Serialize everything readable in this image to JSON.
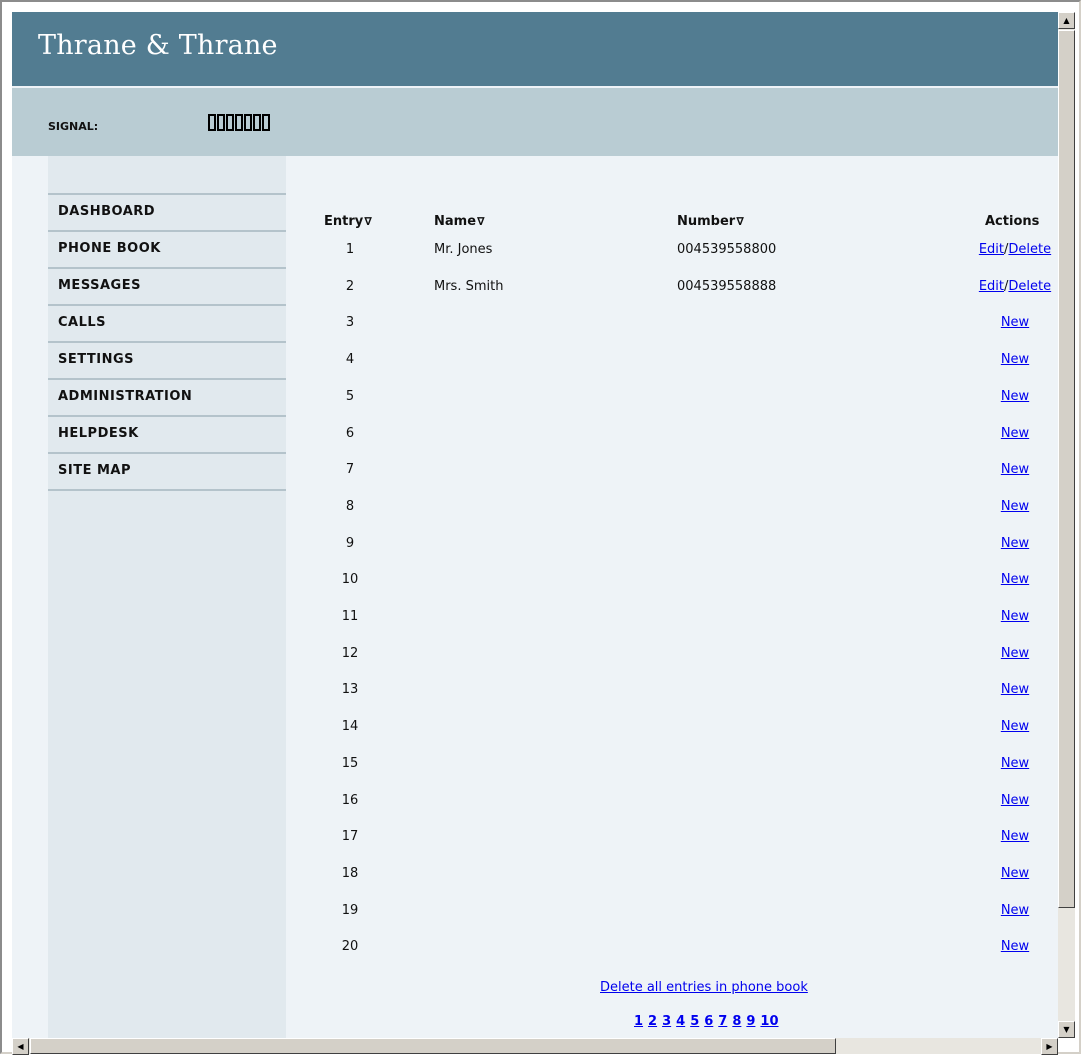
{
  "header": {
    "brand": "Thrane & Thrane"
  },
  "signal": {
    "label": "SIGNAL:",
    "bars": 7
  },
  "sidebar": {
    "items": [
      {
        "label": "DASHBOARD"
      },
      {
        "label": "PHONE BOOK"
      },
      {
        "label": "MESSAGES"
      },
      {
        "label": "CALLS"
      },
      {
        "label": "SETTINGS"
      },
      {
        "label": "ADMINISTRATION"
      },
      {
        "label": "HELPDESK"
      },
      {
        "label": "SITE MAP"
      }
    ]
  },
  "table": {
    "headers": {
      "entry": "Entry",
      "name": "Name",
      "number": "Number",
      "actions": "Actions",
      "sort_glyph": "∇"
    },
    "edit_label": "Edit",
    "separator": "/",
    "delete_label": "Delete",
    "new_label": "New",
    "rows": [
      {
        "entry": "1",
        "name": "Mr. Jones",
        "number": "004539558800"
      },
      {
        "entry": "2",
        "name": "Mrs. Smith",
        "number": "004539558888"
      },
      {
        "entry": "3",
        "name": "",
        "number": ""
      },
      {
        "entry": "4",
        "name": "",
        "number": ""
      },
      {
        "entry": "5",
        "name": "",
        "number": ""
      },
      {
        "entry": "6",
        "name": "",
        "number": ""
      },
      {
        "entry": "7",
        "name": "",
        "number": ""
      },
      {
        "entry": "8",
        "name": "",
        "number": ""
      },
      {
        "entry": "9",
        "name": "",
        "number": ""
      },
      {
        "entry": "10",
        "name": "",
        "number": ""
      },
      {
        "entry": "11",
        "name": "",
        "number": ""
      },
      {
        "entry": "12",
        "name": "",
        "number": ""
      },
      {
        "entry": "13",
        "name": "",
        "number": ""
      },
      {
        "entry": "14",
        "name": "",
        "number": ""
      },
      {
        "entry": "15",
        "name": "",
        "number": ""
      },
      {
        "entry": "16",
        "name": "",
        "number": ""
      },
      {
        "entry": "17",
        "name": "",
        "number": ""
      },
      {
        "entry": "18",
        "name": "",
        "number": ""
      },
      {
        "entry": "19",
        "name": "",
        "number": ""
      },
      {
        "entry": "20",
        "name": "",
        "number": ""
      }
    ]
  },
  "footer": {
    "delete_all": "Delete all entries in phone book",
    "pages": [
      "1",
      "2",
      "3",
      "4",
      "5",
      "6",
      "7",
      "8",
      "9",
      "10"
    ]
  }
}
